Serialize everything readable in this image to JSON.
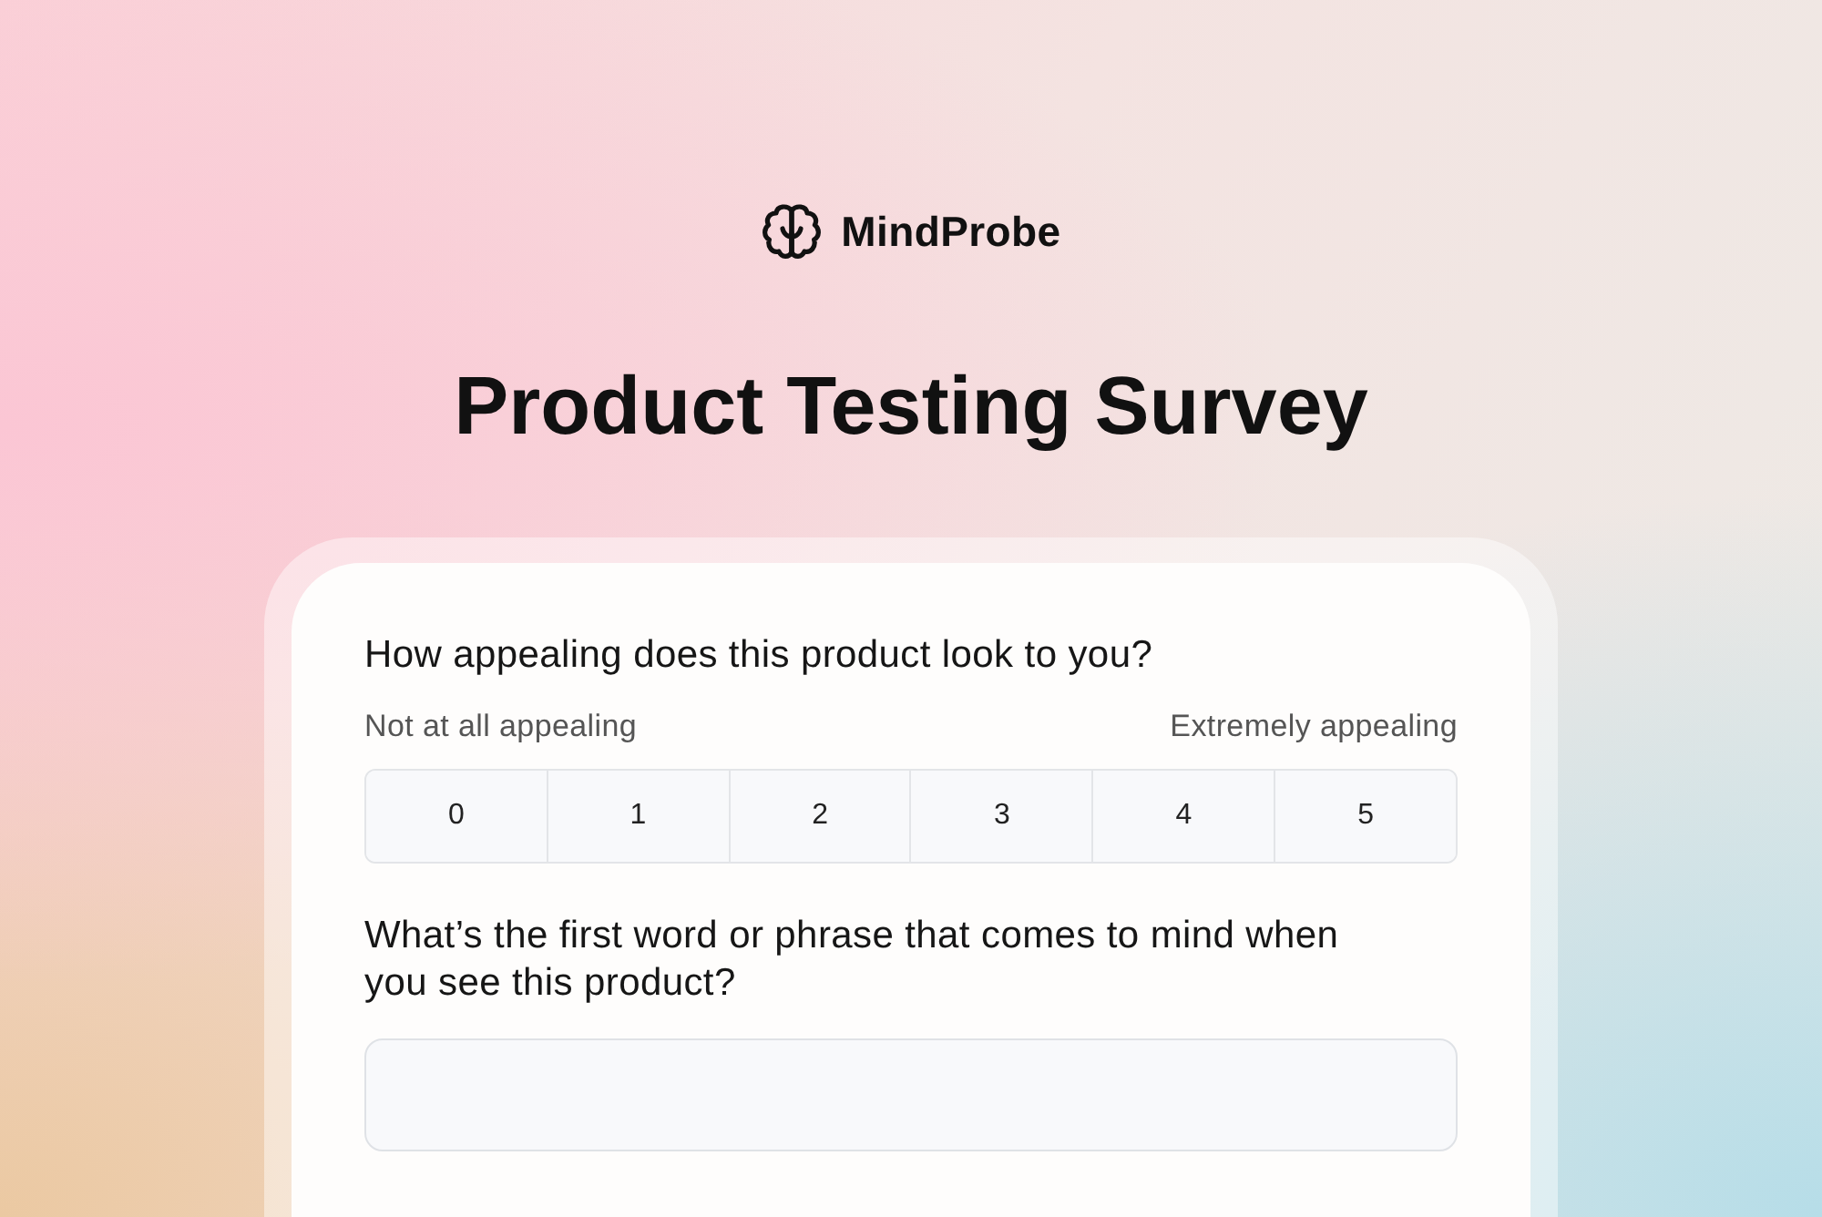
{
  "brand": {
    "name": "MindProbe"
  },
  "title": "Product Testing Survey",
  "questions": [
    {
      "kind": "scale",
      "text": "How appealing does this product look to you?",
      "min_label": "Not at all appealing",
      "max_label": "Extremely appealing",
      "options": [
        {
          "label": "0",
          "selected": false
        },
        {
          "label": "1",
          "selected": false
        },
        {
          "label": "2",
          "selected": false
        },
        {
          "label": "3",
          "selected": false
        },
        {
          "label": "4",
          "selected": false
        },
        {
          "label": "5",
          "selected": false
        }
      ]
    },
    {
      "kind": "text",
      "text": "What’s the first word or phrase that comes to mind when you see this product?"
    }
  ]
}
